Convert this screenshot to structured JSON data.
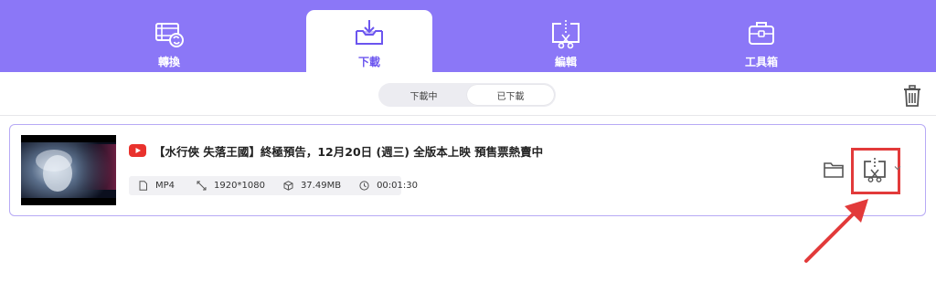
{
  "nav": {
    "tabs": [
      {
        "label": "轉換",
        "icon": "film-convert-icon"
      },
      {
        "label": "下載",
        "icon": "download-tray-icon",
        "active": true
      },
      {
        "label": "編輯",
        "icon": "scissors-screen-icon"
      },
      {
        "label": "工具箱",
        "icon": "toolbox-icon"
      }
    ]
  },
  "toolbar": {
    "segments": [
      {
        "label": "下載中"
      },
      {
        "label": "已下載",
        "active": true
      }
    ],
    "trash_icon": "trash-icon"
  },
  "item": {
    "source_icon": "youtube-icon",
    "title": "【水行俠 失落王國】終極預告，12月20日 (週三) 全版本上映 預售票熱賣中",
    "format": "MP4",
    "resolution": "1920*1080",
    "size": "37.49MB",
    "duration": "00:01:30"
  },
  "colors": {
    "accent": "#8b77f7",
    "accent_dark": "#6b55ef",
    "highlight": "#e23a3a",
    "youtube": "#e9322d"
  }
}
